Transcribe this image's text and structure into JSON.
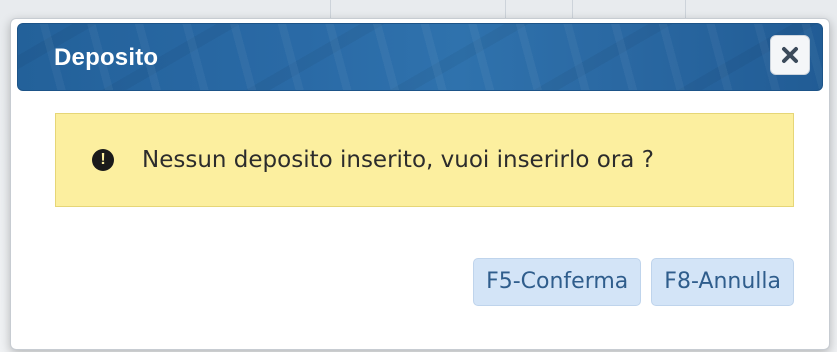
{
  "dialog": {
    "title": "Deposito",
    "close_icon": "close-icon",
    "message_icon": "exclamation-circle-icon",
    "message": "Nessun deposito inserito, vuoi inserirlo ora ?",
    "buttons": {
      "confirm_label": "F5-Conferma",
      "cancel_label": "F8-Annulla"
    }
  },
  "colors": {
    "header": "#2a6aa6",
    "alert_background": "#fcef9f",
    "button_background": "#d3e4f7",
    "button_text": "#2f5d8c"
  }
}
